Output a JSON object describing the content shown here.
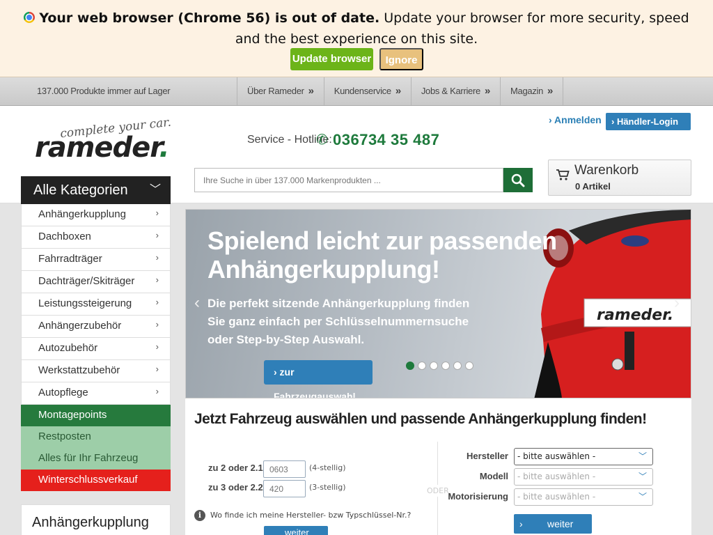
{
  "outdated": {
    "bold": "Your web browser (Chrome 56) is out of date.",
    "rest": " Update your browser for more security, speed and the best experience on this site.",
    "update_label": "Update browser",
    "ignore_label": "Ignore"
  },
  "topbar": {
    "stock": "137.000 Produkte immer auf Lager",
    "nav": [
      "Über Rameder",
      "Kundenservice",
      "Jobs & Karriere",
      "Magazin"
    ]
  },
  "header": {
    "tagline": "complete your car.",
    "logo": "rameder",
    "hotline_label": "Service - Hotline:",
    "hotline_number": "036734 35 487",
    "login": "› Anmelden",
    "dealer_login": "› Händler-Login",
    "search_placeholder": "Ihre Suche in über 137.000 Markenprodukten ...",
    "cart_title": "Warenkorb",
    "cart_count": "0 Artikel"
  },
  "sidebar": {
    "header": "Alle Kategorien",
    "categories": [
      "Anhängerkupplung",
      "Dachboxen",
      "Fahrradträger",
      "Dachträger/Skiträger",
      "Leistungssteigerung",
      "Anhängerzubehör",
      "Autozubehör",
      "Werkstattzubehör",
      "Autopflege"
    ],
    "special": [
      "Montagepoints",
      "Restposten",
      "Alles für Ihr Fahrzeug",
      "Winterschlussverkauf"
    ],
    "promo_title": "Anhängerkupplung"
  },
  "slider": {
    "headline_1": "Spielend leicht zur passenden",
    "headline_2": "Anhängerkupplung!",
    "text_1": "Die perfekt sitzende Anhängerkupplung finden",
    "text_2": "Sie ganz einfach per Schlüsselnummernsuche",
    "text_3": "oder Step-by-Step Auswahl.",
    "cta": "› zur Fahrzeugauswahl",
    "plate": "rameder.",
    "active_slide": 1,
    "slide_count": 6
  },
  "selector": {
    "title": "Jetzt Fahrzeug auswählen und passende Anhängerkupplung finden!",
    "field1_label": "zu 2 oder 2.1",
    "field1_placeholder": "0603",
    "field1_hint": "(4-stellig)",
    "field2_label": "zu 3 oder 2.2",
    "field2_placeholder": "420",
    "field2_hint": "(3-stellig)",
    "or": "ODER",
    "manufacturer_label": "Hersteller",
    "model_label": "Modell",
    "engine_label": "Motorisierung",
    "select_placeholder": "- bitte auswählen -",
    "help": "Wo finde ich meine Hersteller- bzw Typschlüssel-Nr.?",
    "continue": "weiter",
    "continue_left": "weiter"
  },
  "colors": {
    "brand_green": "#1e7a3c",
    "brand_blue": "#2f7fb8",
    "sale_red": "#e5201c",
    "update_green": "#6cb419",
    "ignore_tan": "#e8c17d"
  }
}
